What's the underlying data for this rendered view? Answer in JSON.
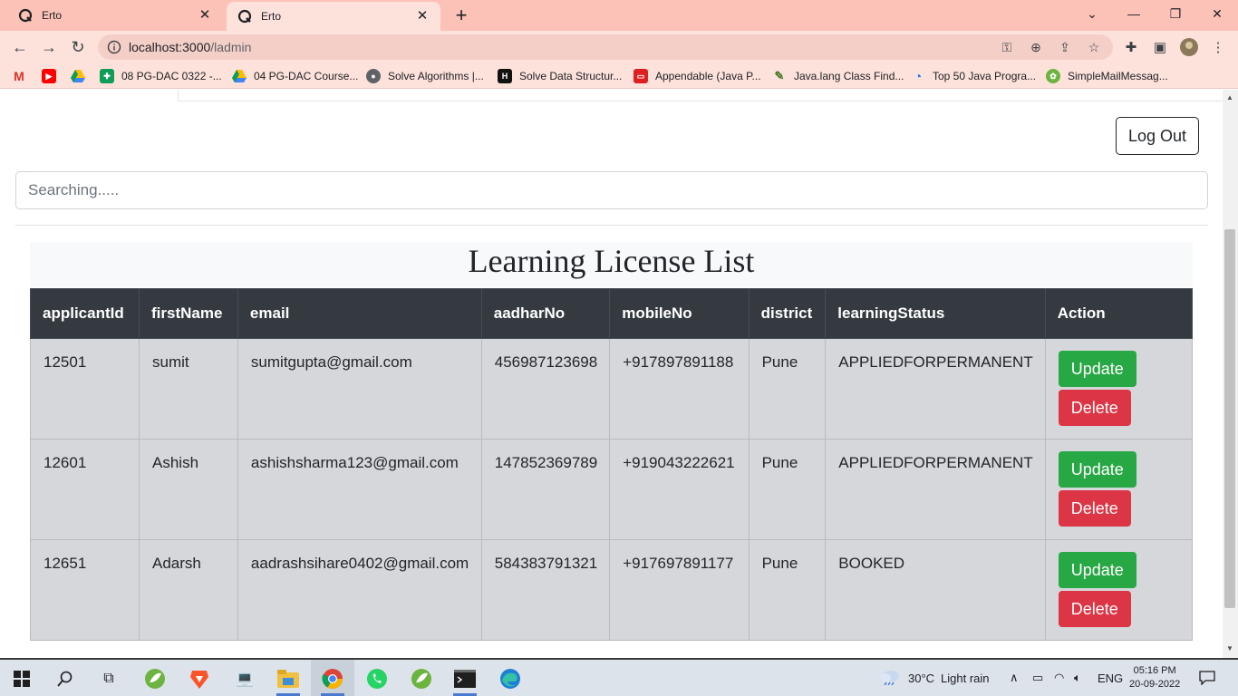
{
  "browser": {
    "tabs": [
      {
        "title": "Erto",
        "close": "✕"
      },
      {
        "title": "Erto",
        "close": "✕"
      }
    ],
    "new_tab": "+",
    "url_host": "localhost:3000",
    "url_path": "/ladmin",
    "bookmarks": [
      {
        "label": "",
        "icon": "gmail-icon"
      },
      {
        "label": "",
        "icon": "youtube-icon"
      },
      {
        "label": "",
        "icon": "drive-icon"
      },
      {
        "label": "08 PG-DAC 0322 -...",
        "icon": "sheets-icon"
      },
      {
        "label": "04 PG-DAC Course...",
        "icon": "drive-icon"
      },
      {
        "label": "Solve Algorithms |...",
        "icon": "globe-icon"
      },
      {
        "label": "Solve Data Structur...",
        "icon": "hackerrank-icon"
      },
      {
        "label": "Appendable (Java P...",
        "icon": "oracle-icon"
      },
      {
        "label": "Java.lang Class Find...",
        "icon": "java-icon"
      },
      {
        "label": "Top 50 Java Progra...",
        "icon": "edureka-icon"
      },
      {
        "label": "SimpleMailMessag...",
        "icon": "spring-icon"
      }
    ]
  },
  "page": {
    "logout_label": "Log Out",
    "search_placeholder": "Searching.....",
    "list_title": "Learning License List",
    "table": {
      "headers": [
        "applicantId",
        "firstName",
        "email",
        "aadharNo",
        "mobileNo",
        "district",
        "learningStatus",
        "Action"
      ],
      "rows": [
        {
          "applicantId": "12501",
          "firstName": "sumit",
          "email": "sumitgupta@gmail.com",
          "aadharNo": "456987123698",
          "mobileNo": "+917897891188",
          "district": "Pune",
          "learningStatus": "APPLIEDFORPERMANENT"
        },
        {
          "applicantId": "12601",
          "firstName": "Ashish",
          "email": "ashishsharma123@gmail.com",
          "aadharNo": "147852369789",
          "mobileNo": "+919043222621",
          "district": "Pune",
          "learningStatus": "APPLIEDFORPERMANENT"
        },
        {
          "applicantId": "12651",
          "firstName": "Adarsh",
          "email": "aadrashsihare0402@gmail.com",
          "aadharNo": "584383791321",
          "mobileNo": "+917697891177",
          "district": "Pune",
          "learningStatus": "BOOKED"
        }
      ],
      "update_label": "Update",
      "delete_label": "Delete"
    }
  },
  "taskbar": {
    "weather_temp": "30°C",
    "weather_desc": "Light rain",
    "language": "ENG",
    "time": "05:16 PM",
    "date": "20-09-2022"
  },
  "colors": {
    "tabbar": "#fcc2b8",
    "table_header": "#343a40",
    "row_bg": "#d6d7da",
    "update_btn": "#28a745",
    "delete_btn": "#dc3545"
  }
}
